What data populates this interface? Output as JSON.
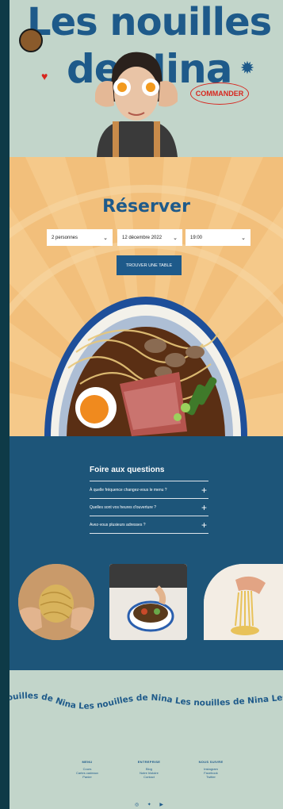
{
  "hero": {
    "title_line1": "Les nouilles",
    "title_line2": "de Nina",
    "order_button": "COMMANDER"
  },
  "reservation": {
    "title": "Réserver",
    "people": "2 personnes",
    "date": "12 décembre 2022",
    "time": "19:00",
    "submit": "TROUVER UNE TABLE"
  },
  "faq": {
    "title": "Foire aux questions",
    "questions": [
      "À quelle fréquence changez-vous le menu ?",
      "Quelles sont vos heures d'ouverture ?",
      "Avez-vous plusieurs adresses ?"
    ]
  },
  "marquee": {
    "text": "nouilles de Nina  Les nouilles de Nina  Les nouilles de Nina  Les no"
  },
  "footer": {
    "columns": [
      {
        "heading": "MENU",
        "links": [
          "Cours",
          "Cartes cadeaux",
          "Panier"
        ]
      },
      {
        "heading": "ENTREPRISE",
        "links": [
          "Blog",
          "Notre histoire",
          "Contact"
        ]
      },
      {
        "heading": "NOUS SUIVRE",
        "links": [
          "Instagram",
          "Facebook",
          "Twitter"
        ]
      }
    ]
  },
  "colors": {
    "brand_blue": "#1e5a8a",
    "accent_red": "#d7261e",
    "sage": "#c2d5ca",
    "peach": "#f5c98a",
    "faq_bg": "#1d5579"
  },
  "icons": [
    "logo-badge-icon",
    "heart-icon",
    "bowl-star-icon",
    "chevron-down-icon",
    "plus-icon",
    "instagram-icon",
    "twitter-icon",
    "youtube-icon"
  ]
}
